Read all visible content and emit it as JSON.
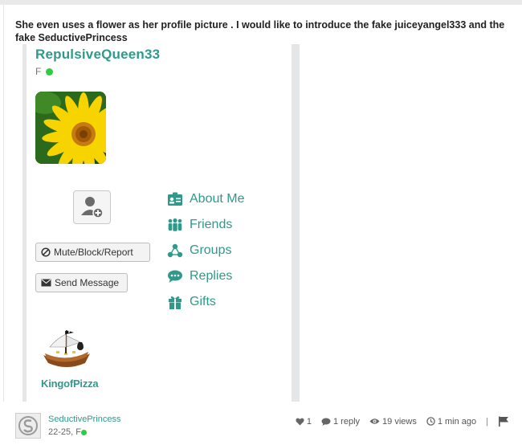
{
  "post": {
    "title": "She even uses a flower as her profile picture . I would like to introduce the fake juiceyangel333 and the fake SeductivePrincess"
  },
  "profile": {
    "username": "RepulsiveQueen33",
    "gender": "F",
    "avatar_icon": "yellow-flower-photo",
    "buttons": {
      "mute_label": "Mute/Block/Report",
      "message_label": "Send Message"
    },
    "menu": [
      {
        "label": "About Me",
        "icon": "id-card-icon"
      },
      {
        "label": "Friends",
        "icon": "people-icon"
      },
      {
        "label": "Groups",
        "icon": "groups-icon"
      },
      {
        "label": "Replies",
        "icon": "speech-bubble-icon"
      },
      {
        "label": "Gifts",
        "icon": "gift-icon"
      }
    ],
    "friend": {
      "name": "KingofPizza",
      "avatar_icon": "pirate-ship-icon"
    }
  },
  "footer": {
    "username": "SeductivePrincess",
    "meta": "22-25, F",
    "likes": "1",
    "replies": "1 reply",
    "views": "19 views",
    "time": "1 min ago",
    "separator": "|"
  },
  "colors": {
    "accent": "#2f9a8a",
    "online": "#2ecc40"
  }
}
